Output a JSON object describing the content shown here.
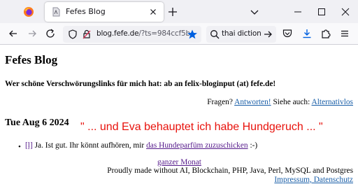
{
  "browser": {
    "tab_title": "Fefes Blog",
    "url_host": "blog.fefe.de",
    "url_path": "/?ts=984ccf5b",
    "search_text": "thai diction"
  },
  "icons": {
    "firefox": "firefox-logo-icon",
    "tab_favicon": "page-favicon-icon",
    "tab_close": "close-icon",
    "new_tab": "plus-icon",
    "list_all_tabs": "chevron-down-icon",
    "minimize": "minimize-icon",
    "maximize": "maximize-icon",
    "close_window": "close-icon",
    "back": "arrow-left-icon",
    "forward": "arrow-right-icon",
    "reload": "reload-icon",
    "shield": "shield-icon",
    "lock": "lock-icon",
    "bookmark": "star-icon",
    "search_go": "arrow-right-icon",
    "pocket": "pocket-icon",
    "downloads": "download-icon",
    "extensions": "puzzle-icon",
    "menu": "hamburger-menu-icon"
  },
  "colors": {
    "bookmark_star": "#0060df",
    "download_accent": "#0060df",
    "quote_red": "#e8120c",
    "link_blue": "#1a5fa8",
    "visited_purple": "#551a8b"
  },
  "page": {
    "title": "Fefes Blog",
    "tagline": "Wer schöne Verschwörungslinks für mich hat: ab an felix-bloginput (at) fefe.de!",
    "links_prefix": "Fragen?",
    "link_answers": "Antworten!",
    "links_middle": "Siehe auch:",
    "link_alternatives": "Alternativlos",
    "post_date": "Tue Aug 6 2024",
    "quote": "\" ... und Eva behauptet ich habe Hundgeruch ... \"",
    "post_permalink": "[l]",
    "post_text": "Ja. Ist gut. Ihr könnt aufhören, mir",
    "post_link": "das Hundeparfüm zuzuschicken",
    "post_suffix": ":-)",
    "month_link": "ganzer Monat",
    "footer": "Proudly made without AI, Blockchain, PHP, Java, Perl, MySQL and Postgres",
    "imprint": "Impressum, Datenschutz"
  }
}
